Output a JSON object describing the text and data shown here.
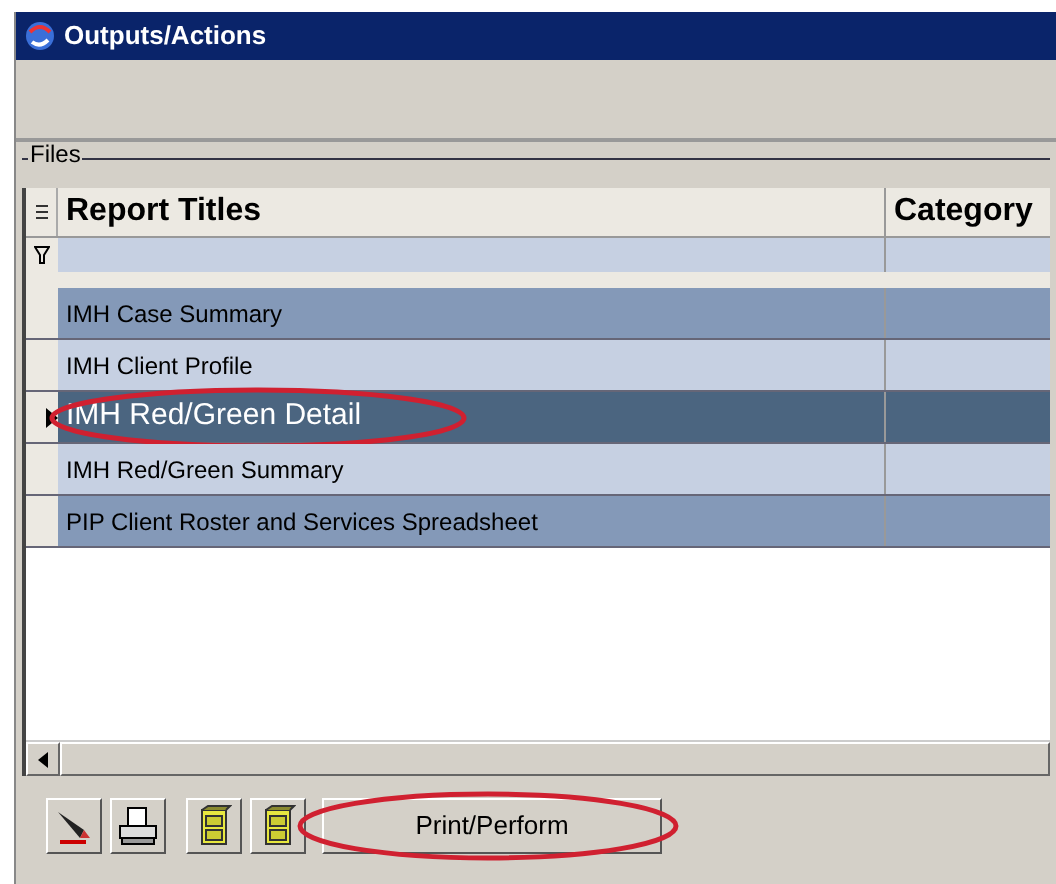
{
  "window": {
    "title": "Outputs/Actions"
  },
  "group": {
    "label": "Files"
  },
  "table": {
    "columns": [
      "Report Titles",
      "Category"
    ],
    "rows": [
      {
        "title": "IMH Case Summary",
        "selected": false,
        "highlighted": false
      },
      {
        "title": "IMH Client Profile",
        "selected": false,
        "highlighted": false
      },
      {
        "title": "IMH Red/Green Detail",
        "selected": true,
        "highlighted": true
      },
      {
        "title": "IMH Red/Green Summary",
        "selected": false,
        "highlighted": false
      },
      {
        "title": "PIP Client Roster and Services Spreadsheet",
        "selected": false,
        "highlighted": false
      }
    ]
  },
  "toolbar": {
    "buttons": [
      {
        "kind": "pen"
      },
      {
        "kind": "printer"
      },
      {
        "kind": "cabinet"
      },
      {
        "kind": "cabinet"
      }
    ]
  },
  "action_button": {
    "label": "Print/Perform",
    "highlighted": true
  }
}
